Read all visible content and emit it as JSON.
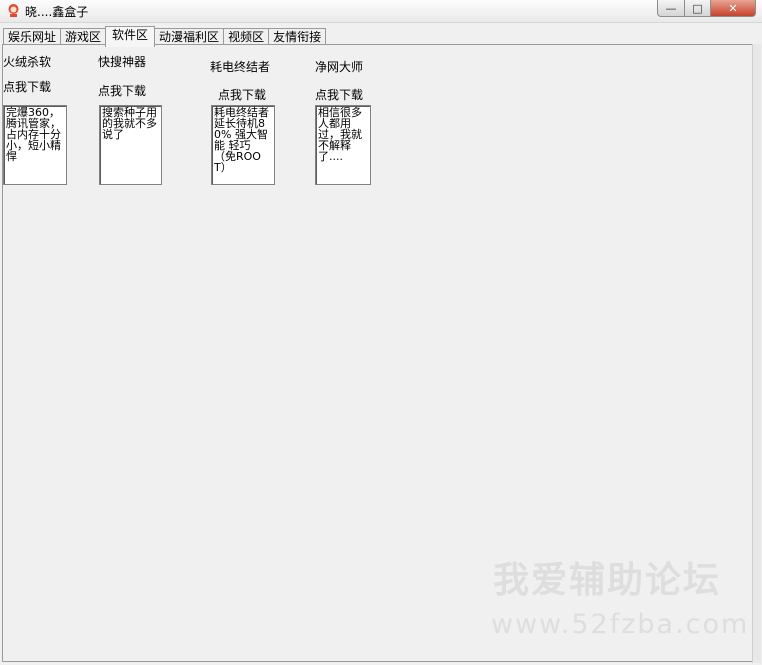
{
  "window": {
    "title": "晓....鑫盒子",
    "min_glyph": "—",
    "max_glyph": "□",
    "close_glyph": "✕"
  },
  "tabs": [
    {
      "label": "娱乐网址"
    },
    {
      "label": "游戏区"
    },
    {
      "label": "软件区",
      "active": true
    },
    {
      "label": "动漫福利区"
    },
    {
      "label": "视频区"
    },
    {
      "label": "友情衔接"
    }
  ],
  "software": [
    {
      "name": "火绒杀软",
      "download": "点我下载",
      "description": "  完爆360，腾讯管家，占内存十分小，短小精悍"
    },
    {
      "name": "快搜神器",
      "download": "点我下载",
      "description": "搜索种子用的我就不多说了"
    },
    {
      "name": "耗电终结者",
      "download": "点我下载",
      "description": "  耗电终结者 延长待机80% 强大智能 轻巧（免ROOT）"
    },
    {
      "name": "净网大师",
      "download": "点我下载",
      "description": "相信很多人都用过，我就不解释了...."
    }
  ],
  "watermark": {
    "text": "我爱辅助论坛",
    "url": "www.52fzba.com"
  }
}
